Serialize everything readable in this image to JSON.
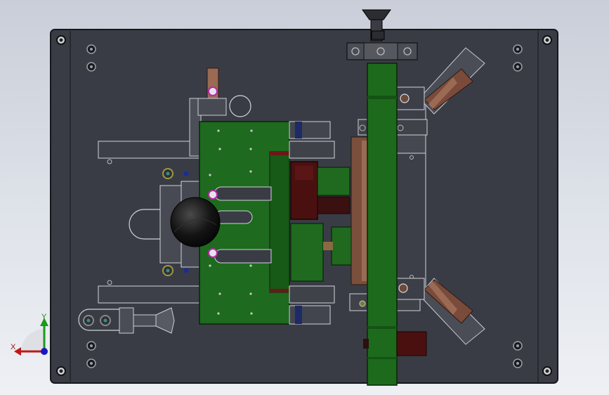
{
  "viewport": {
    "background_top": "#c9ced8",
    "background_bottom": "#eef0f4"
  },
  "colors": {
    "plate": "#3a3c45",
    "plate_edge": "#1b1c22",
    "green_part": "#1e6a1e",
    "dark_red_part": "#4a1010",
    "brown_part": "#8a5a45",
    "grey_part": "#565a66",
    "sphere": "#141414",
    "axis_x": "#c01818",
    "axis_y": "#1a9a1a",
    "axis_z": "#1818c0"
  },
  "triad": {
    "x_label": "X",
    "y_label": "Y"
  }
}
